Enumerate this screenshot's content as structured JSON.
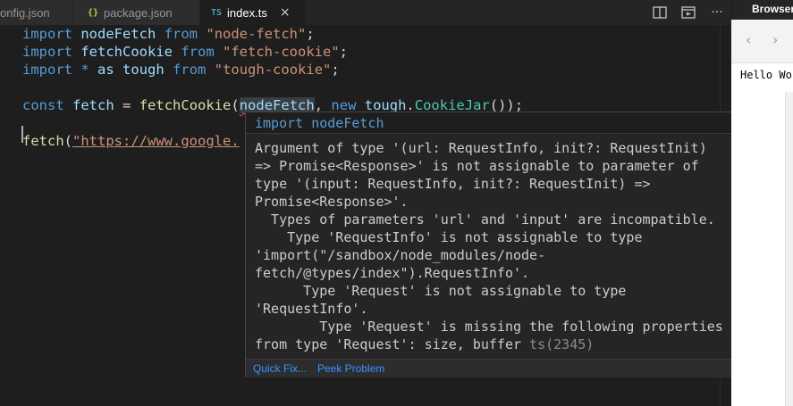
{
  "tabs": [
    {
      "label": "onfig.json",
      "icon": "json-icon"
    },
    {
      "label": "package.json",
      "icon": "json-icon",
      "icon_text": "{}"
    },
    {
      "label": "index.ts",
      "icon": "typescript-icon",
      "icon_text": "TS",
      "active": true,
      "close": "×"
    }
  ],
  "tab_actions": [
    "split-editor-icon",
    "open-preview-icon",
    "more-actions-icon"
  ],
  "tab_actions_more": "···",
  "code": {
    "l1": {
      "kw": "import",
      "name": "nodeFetch",
      "from": "from",
      "str": "\"node-fetch\"",
      "semi": ";"
    },
    "l2": {
      "kw": "import",
      "name": "fetchCookie",
      "from": "from",
      "str": "\"fetch-cookie\"",
      "semi": ";"
    },
    "l3": {
      "kw": "import",
      "star": "*",
      "as": "as",
      "name": "tough",
      "from": "from",
      "str": "\"tough-cookie\"",
      "semi": ";"
    },
    "l5": {
      "kw": "const",
      "name": "fetch",
      "eq": "=",
      "fn": "fetchCookie",
      "p1": "(",
      "arg": "nodeFetch",
      "comma": ",",
      "new": "new",
      "ns": "tough",
      "dot": ".",
      "cls": "CookieJar",
      "end": "());"
    },
    "l7": {
      "fn": "fetch",
      "p1": "(",
      "str": "\"https://www.google."
    }
  },
  "hover": {
    "signature": "import nodeFetch",
    "message_lines": [
      "Argument of type '(url: RequestInfo, init?: RequestInit)",
      "=> Promise<Response>' is not assignable to parameter of",
      "type '(input: RequestInfo, init?: RequestInit) =>",
      "Promise<Response>'.",
      "  Types of parameters 'url' and 'input' are incompatible.",
      "    Type 'RequestInfo' is not assignable to type",
      "'import(\"/sandbox/node_modules/node-",
      "fetch/@types/index\").RequestInfo'.",
      "      Type 'Request' is not assignable to type",
      "'RequestInfo'.",
      "        Type 'Request' is missing the following properties",
      "from type 'Request': size, buffer"
    ],
    "error_code": "ts(2345)",
    "quick_fix": "Quick Fix...",
    "peek_problem": "Peek Problem"
  },
  "browser": {
    "title": "Browser",
    "back": "‹",
    "forward": "›",
    "content": "Hello World"
  },
  "colors": {
    "keyword": "#569cd6",
    "variable": "#9cdcfe",
    "function": "#dcdcaa",
    "string": "#ce9178",
    "type": "#4ec9b0",
    "link": "#3794ff",
    "error": "#f14c4c"
  }
}
